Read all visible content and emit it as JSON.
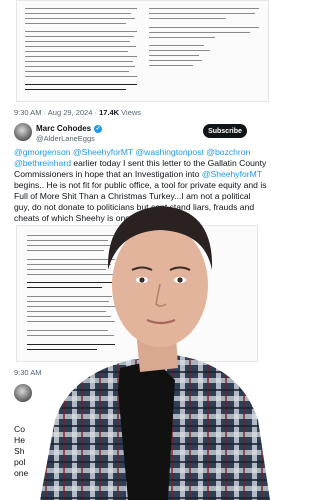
{
  "post1": {
    "timestamp": "9:30 AM · Aug 29, 2024 · ",
    "views_count": "17.4K",
    "views_label": " Views"
  },
  "post2": {
    "author_name": "Marc Cohodes",
    "author_handle": "@AlderLaneEggs",
    "subscribe_label": "Subscribe",
    "mentions": [
      "@gmorgenson",
      "@SheehyforMT",
      "@washingtonpost",
      "@bozchron",
      "@bethreinhard"
    ],
    "text_1": " earlier today I sent this letter to the Gallatin County Commissioners in hope that an Investigation into ",
    "mention_inline": "@SheehyforMT",
    "text_2": " begins.. He is not fit for public office, a tool for private equity and is Full of More Shit Than a Christmas Turkey...I am not a political guy, do not donate to politicians but cant stand liars, frauds and cheats of which Sheehy is one."
  },
  "post3": {
    "timestamp": "9:30 AM",
    "partial_text": [
      "Co",
      "He",
      "Sh",
      "pol",
      "one"
    ]
  },
  "colors": {
    "link": "#1d9bf0",
    "meta": "#536471",
    "text": "#0f1419"
  },
  "icons": [
    "verified-badge-icon"
  ]
}
